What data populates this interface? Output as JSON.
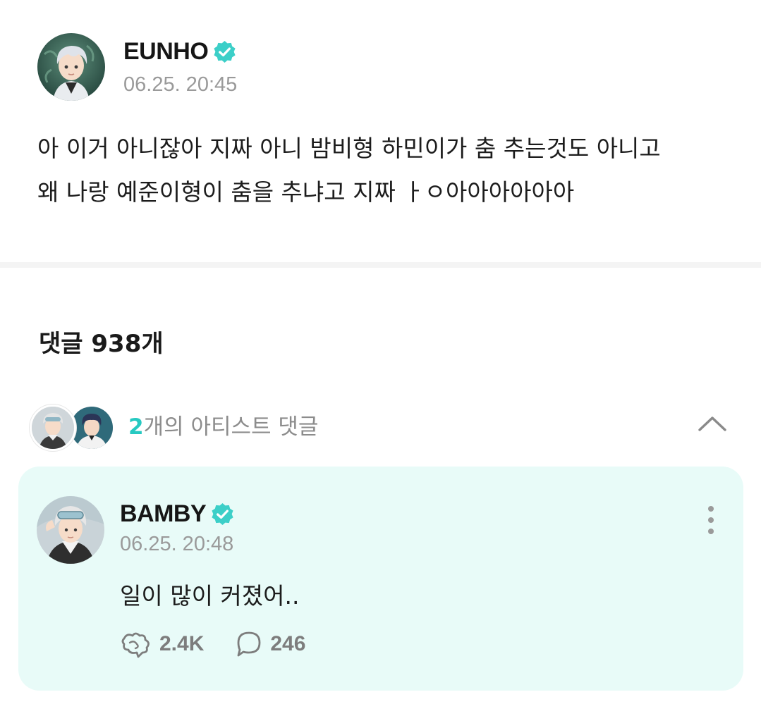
{
  "post": {
    "author": "EUNHO",
    "timestamp": "06.25. 20:45",
    "lines": [
      "아 이거 아니잖아 지짜 아니 밤비형 하민이가 춤 추는것도 아니고",
      "왜 나랑 예준이형이 춤을 추냐고 지짜 ㅏㅇ아아아아아아"
    ]
  },
  "comments": {
    "title": "댓글 938개"
  },
  "artist_comments": {
    "count": "2",
    "label": "개의 아티스트 댓글",
    "icons": {
      "collapse": "chevron-up-icon"
    }
  },
  "featured_comment": {
    "author": "BAMBY",
    "timestamp": "06.25. 20:48",
    "text": "일이 많이 커졌어..",
    "likes": "2.4K",
    "replies": "246",
    "icons": {
      "like": "like-icon",
      "reply": "reply-icon",
      "more": "more-vertical-icon"
    }
  },
  "colors": {
    "accent": "#26c9c1",
    "card_background": "#e8fbf8",
    "verified": "#3ccfc8",
    "muted_text": "#9a9a9a"
  }
}
